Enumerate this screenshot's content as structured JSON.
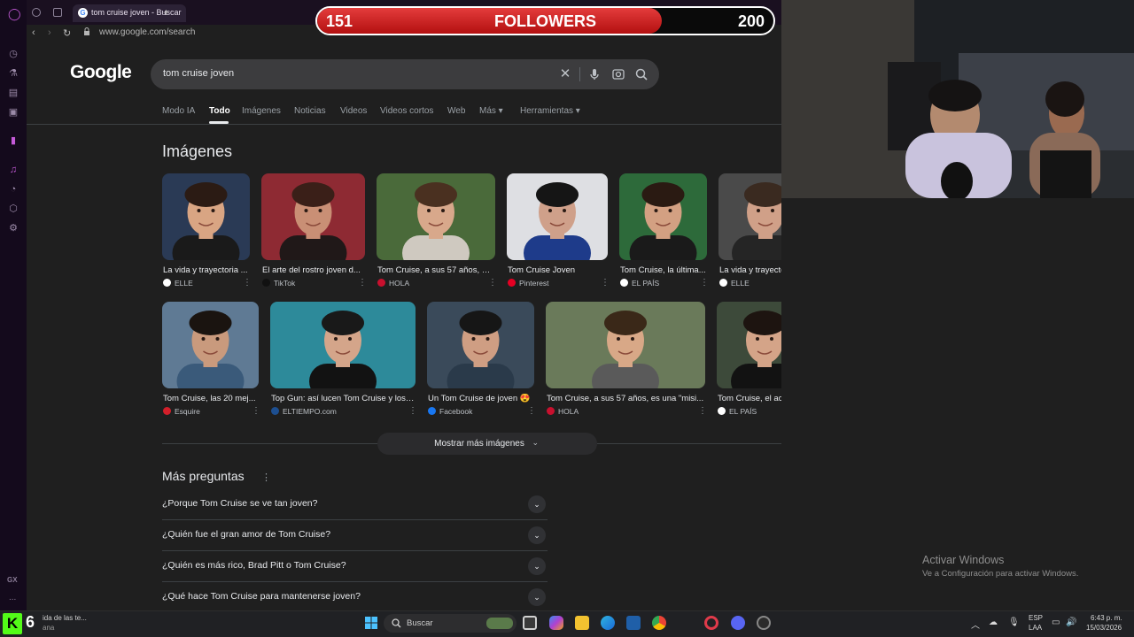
{
  "browser": {
    "tab_title": "tom cruise joven - Buscar c",
    "url": "www.google.com/search"
  },
  "overlay": {
    "current": "151",
    "label": "FOLLOWERS",
    "goal": "200",
    "progress_fraction": 0.755
  },
  "google": {
    "logo": "Google",
    "query": "tom cruise joven",
    "tabs": [
      "Modo IA",
      "Todo",
      "Imágenes",
      "Noticias",
      "Videos",
      "Videos cortos",
      "Web",
      "Más",
      "Herramientas"
    ],
    "active_tab": "Todo"
  },
  "images_section": {
    "title": "Imágenes",
    "row1": [
      {
        "caption": "La vida y trayectoria ...",
        "source": "ELLE"
      },
      {
        "caption": "El arte del rostro joven d...",
        "source": "TikTok"
      },
      {
        "caption": "Tom Cruise, a sus 57 años, es...",
        "source": "HOLA"
      },
      {
        "caption": "Tom Cruise Joven",
        "source": "Pinterest"
      },
      {
        "caption": "Tom Cruise, la última...",
        "source": "EL PAÍS"
      },
      {
        "caption": "La vida y trayectoria c...",
        "source": "ELLE"
      }
    ],
    "row2": [
      {
        "caption": "Tom Cruise, las 20 mej...",
        "source": "Esquire"
      },
      {
        "caption": "Top Gun: así lucen Tom Cruise y los ...",
        "source": "ELTIEMPO.com"
      },
      {
        "caption": "Un Tom Cruise de joven 😍",
        "source": "Facebook"
      },
      {
        "caption": "Tom Cruise, a sus 57 años, es una \"misi...",
        "source": "HOLA"
      },
      {
        "caption": "Tom Cruise, el actor qu...",
        "source": "EL PAÍS"
      }
    ],
    "more_button": "Mostrar más imágenes"
  },
  "people_also_ask": {
    "title": "Más preguntas",
    "questions": [
      "¿Porque Tom Cruise se ve tan joven?",
      "¿Quién fue el gran amor de Tom Cruise?",
      "¿Quién es más rico, Brad Pitt o Tom Cruise?",
      "¿Qué hace Tom Cruise para mantenerse joven?"
    ]
  },
  "watermark": {
    "line1": "Activar Windows",
    "line2": "Ve a Configuración para activar Windows."
  },
  "taskbar": {
    "kick_count": "6",
    "media_line1": "ida de las te...",
    "media_line2": "ana",
    "search_placeholder": "Buscar",
    "lang1": "ESP",
    "lang2": "LAA",
    "time": "6:43 p. m.",
    "date": "15/03/2026"
  },
  "sidebar": {
    "gx_label": "GX",
    "more": "..."
  }
}
